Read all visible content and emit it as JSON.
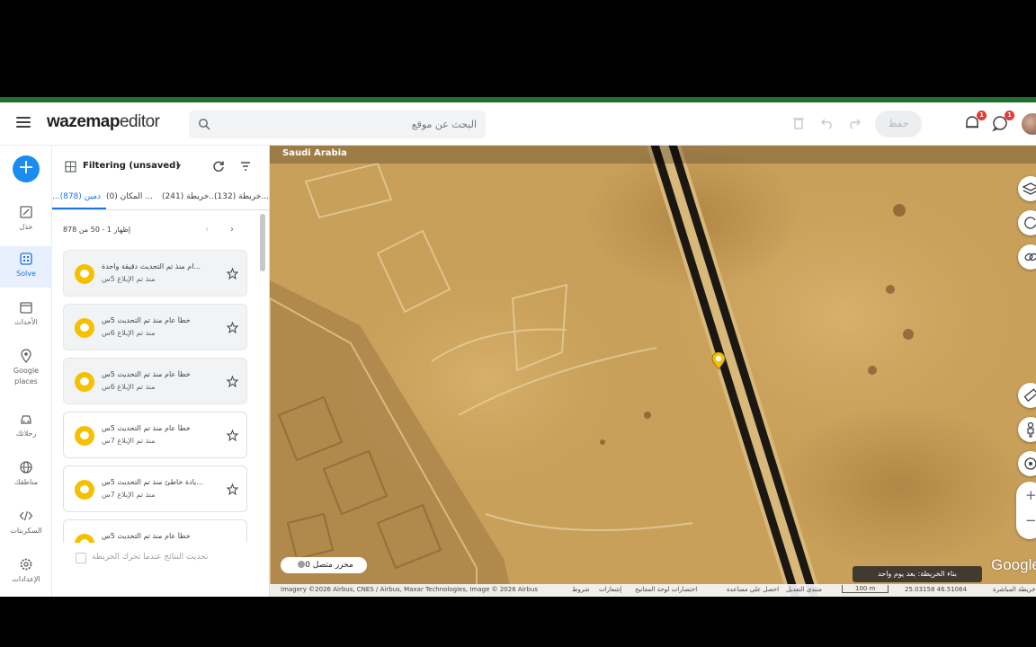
{
  "app": {
    "logo_bold": "wazemap",
    "logo_light": "editor",
    "search_placeholder": "البحث عن موقع",
    "save_label": "حفظ",
    "notif_count_1": "1",
    "notif_count_2": "1"
  },
  "rail": {
    "items": [
      {
        "label": "خذل"
      },
      {
        "label": "Solve"
      },
      {
        "label": "الأحداث"
      },
      {
        "label": "Google places"
      },
      {
        "label": "رحلاتك"
      },
      {
        "label": "مناطقك"
      },
      {
        "label": "السكربتات"
      },
      {
        "label": "الإعدادات"
      }
    ]
  },
  "panel": {
    "filter_label": "Filtering (unsaved)",
    "tabs": [
      {
        "label": "...دمين (878)"
      },
      {
        "label": "المكان (0) ..."
      },
      {
        "label": "خريطة (241)..."
      },
      {
        "label": "خريطة (132)..."
      }
    ],
    "pager_text": "إظهار 1 - 50 من 878",
    "items": [
      {
        "title": "...ام منذ تم التحديث دقيقة واحدة",
        "subtitle": "منذ تم الإبلاغ 5س"
      },
      {
        "title": "خطأ عام منذ تم التحديث 5س",
        "subtitle": "منذ تم الإبلاغ 6س"
      },
      {
        "title": "خطأ عام منذ تم التحديث 5س",
        "subtitle": "منذ تم الإبلاغ 6س"
      },
      {
        "title": "خطأ عام منذ تم التحديث 5س",
        "subtitle": "منذ تم الإبلاغ 7س"
      },
      {
        "title": "...يادة خاطئ منذ تم التحديث 5س",
        "subtitle": "منذ تم الإبلاغ 7س"
      },
      {
        "title": "خطأ عام منذ تم التحديث 5س",
        "subtitle": ""
      }
    ],
    "footer_check_label": "تحديث النتائج عندما تحرك الخريطة"
  },
  "map": {
    "country": "Saudi Arabia",
    "online_label": "محرر متصل 0",
    "build_label": "بناء الخريطة: بعد يوم واحد",
    "google_label": "Google",
    "attribution": [
      "Imagery ©2026 Airbus, CNES / Airbus, Maxar Technologies, Image © 2026 Airbus",
      "شروط",
      "إشعارات",
      "اختصارات لوحة المفاتيح",
      "احصل على مساعدة",
      "منتدى التعديل",
      "100 m",
      "25.03158 46.51064",
      "خريطة المباشرة"
    ]
  },
  "colors": {
    "accent": "#1a73e8",
    "fab": "#1a8cf0",
    "waze_yellow": "#f6c000",
    "top_green": "#1f6e2c",
    "badge_red": "#e53935"
  }
}
